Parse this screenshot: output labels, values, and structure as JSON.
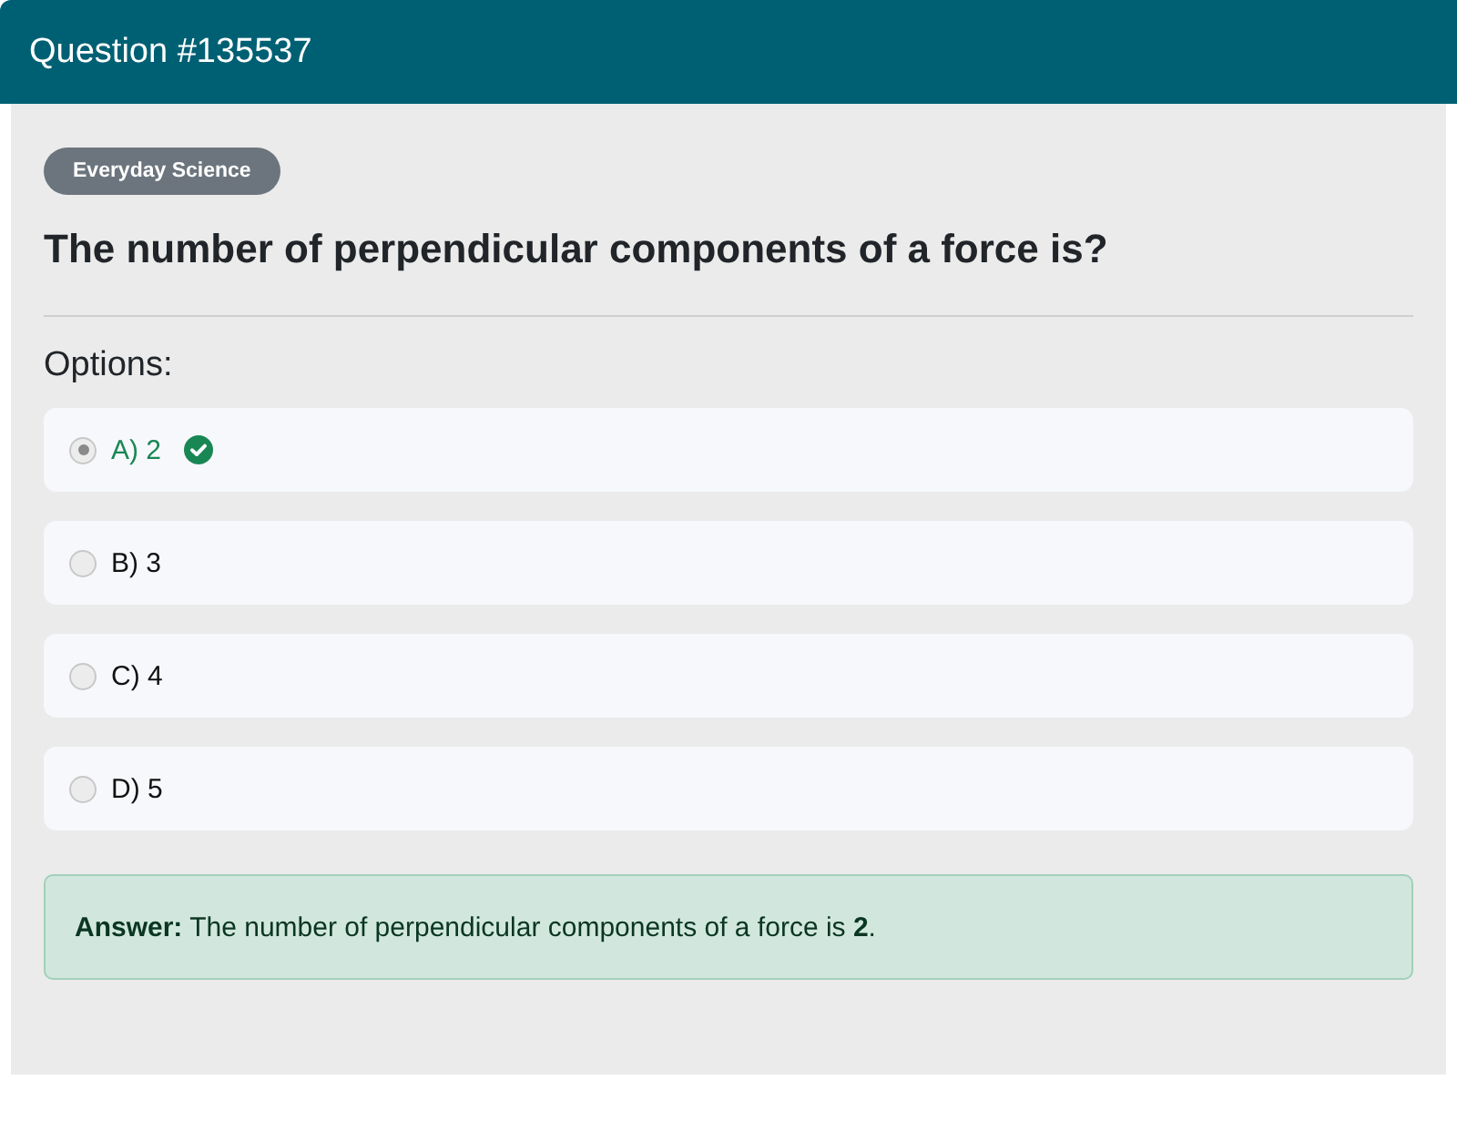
{
  "header": {
    "title": "Question #135537"
  },
  "category": "Everyday Science",
  "question": "The number of perpendicular components of a force is?",
  "options_label": "Options:",
  "options": [
    {
      "label": "A) 2",
      "selected": true,
      "correct": true
    },
    {
      "label": "B) 3",
      "selected": false,
      "correct": false
    },
    {
      "label": "C) 4",
      "selected": false,
      "correct": false
    },
    {
      "label": "D) 5",
      "selected": false,
      "correct": false
    }
  ],
  "answer": "**Answer:** The number of perpendicular components of a force is **2**."
}
